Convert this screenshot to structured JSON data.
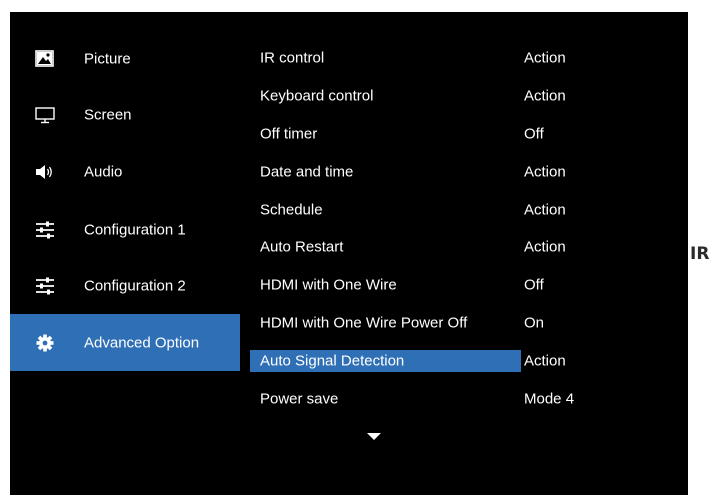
{
  "sidebar": {
    "items": [
      {
        "label": "Picture",
        "icon": "picture-icon"
      },
      {
        "label": "Screen",
        "icon": "monitor-icon"
      },
      {
        "label": "Audio",
        "icon": "speaker-icon"
      },
      {
        "label": "Configuration 1",
        "icon": "sliders-icon"
      },
      {
        "label": "Configuration 2",
        "icon": "sliders-icon"
      },
      {
        "label": "Advanced Option",
        "icon": "gear-icon",
        "selected": true
      }
    ]
  },
  "settings": {
    "rows": [
      {
        "name": "IR control",
        "value": "Action"
      },
      {
        "name": "Keyboard control",
        "value": "Action"
      },
      {
        "name": "Off timer",
        "value": "Off"
      },
      {
        "name": "Date and time",
        "value": "Action"
      },
      {
        "name": "Schedule",
        "value": "Action"
      },
      {
        "name": "Auto Restart",
        "value": "Action"
      },
      {
        "name": "HDMI with One Wire",
        "value": "Off"
      },
      {
        "name": "HDMI with One Wire Power Off",
        "value": "On"
      },
      {
        "name": "Auto Signal Detection",
        "value": "Action",
        "highlighted": true
      },
      {
        "name": "Power save",
        "value": "Mode 4"
      }
    ],
    "more_indicator": "scroll-down-arrow-icon"
  },
  "side_caption": "IR",
  "colors": {
    "osd_background": "#000000",
    "highlight": "#2f6fb5",
    "text": "#ffffff"
  }
}
